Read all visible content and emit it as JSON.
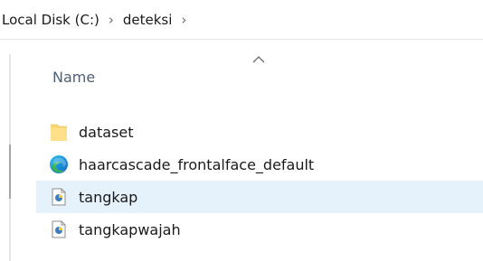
{
  "breadcrumb": {
    "items": [
      {
        "label": "Local Disk (C:)"
      },
      {
        "label": "deteksi"
      }
    ],
    "separator": "›"
  },
  "columns": {
    "name_label": "Name",
    "sort_direction": "ascending"
  },
  "files": [
    {
      "name": "dataset",
      "icon": "folder-icon",
      "selected": false
    },
    {
      "name": "haarcascade_frontalface_default",
      "icon": "edge-browser-icon",
      "selected": false
    },
    {
      "name": "tangkap",
      "icon": "python-file-icon",
      "selected": true
    },
    {
      "name": "tangkapwajah",
      "icon": "python-file-icon",
      "selected": false
    }
  ],
  "colors": {
    "selection": "#e5f1fb",
    "header_text": "#4c607a",
    "folder": "#f8d775"
  }
}
